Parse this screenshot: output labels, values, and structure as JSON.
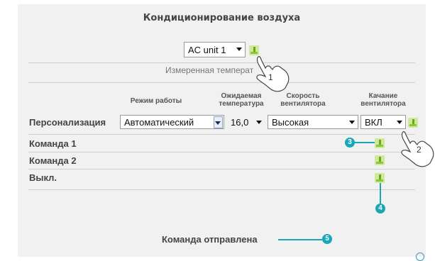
{
  "header": {
    "title": "Кондиционирование воздуха"
  },
  "unit_select": {
    "value": "AC unit 1"
  },
  "measured": {
    "label": "Измеренная температ"
  },
  "columns": {
    "mode": "Режим работы",
    "expected_temp_line1": "Ожидаемая",
    "expected_temp_line2": "температура",
    "fan_speed_line1": "Скорость",
    "fan_speed_line2": "вентилятора",
    "swing_line1": "Качание",
    "swing_line2": "вентилятора"
  },
  "personalization": {
    "label": "Персонализация",
    "mode": "Автоматический",
    "temperature": "16,0",
    "fan_speed": "Высокая",
    "swing": "ВКЛ"
  },
  "commands": [
    {
      "label": "Команда 1"
    },
    {
      "label": "Команда 2"
    },
    {
      "label": "Выкл."
    }
  ],
  "status": {
    "sent": "Команда отправлена"
  },
  "callouts": {
    "c1": "1",
    "c2": "2",
    "c3": "3",
    "c4": "4",
    "c5": "5"
  },
  "colors": {
    "callout": "#1aa6b6",
    "send_icon": "#8cc63f",
    "panel": "#f1f1f1"
  },
  "icons": {
    "send": "send-arrow-icon",
    "pointer": "hand-pointer-icon"
  }
}
